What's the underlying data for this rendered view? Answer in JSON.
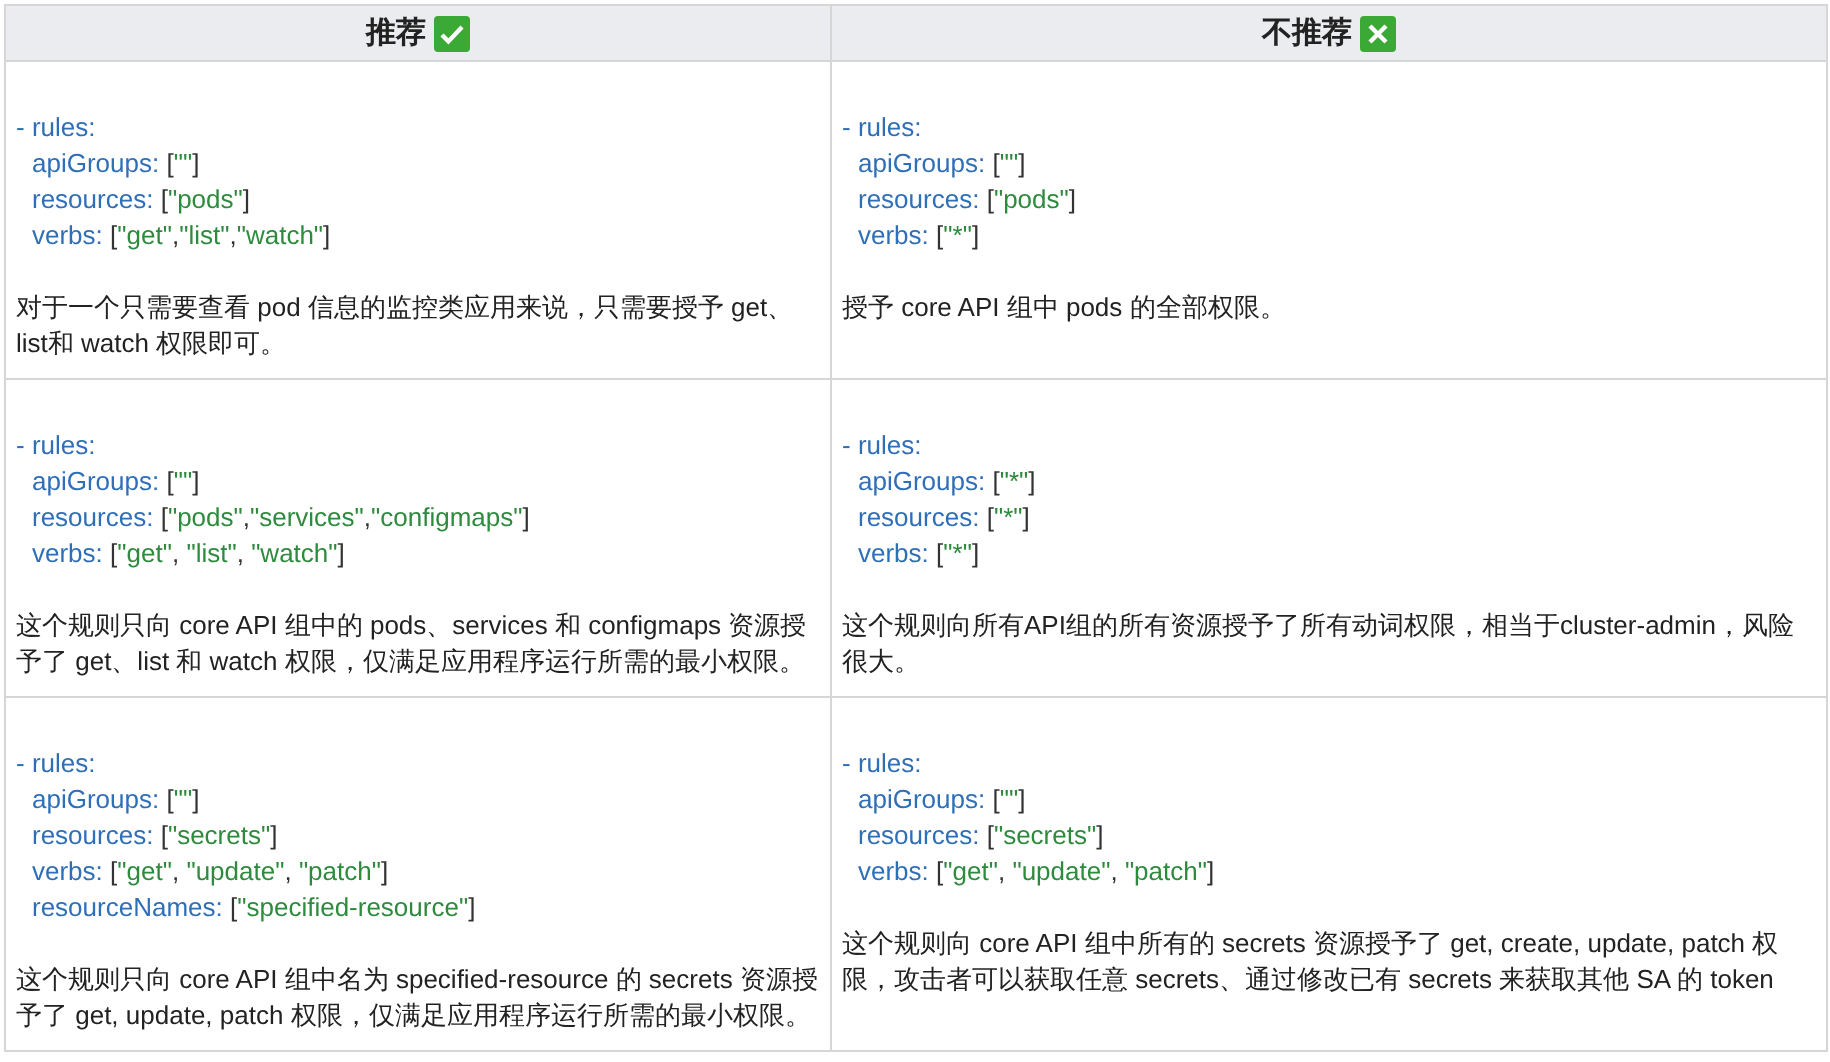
{
  "table": {
    "columns": [
      {
        "label": "推荐",
        "kind": "check"
      },
      {
        "label": "不推荐",
        "kind": "cross"
      }
    ],
    "rows": [
      {
        "cells": [
          {
            "code": [
              {
                "key": "- rules:",
                "children": [
                  {
                    "key": "apiGroups:",
                    "value": "[\"\"]"
                  },
                  {
                    "key": "resources:",
                    "value": "[\"pods\"]"
                  },
                  {
                    "key": "verbs:",
                    "value": "[\"get\",\"list\",\"watch\"]"
                  }
                ]
              }
            ],
            "description": "对于一个只需要查看 pod 信息的监控类应用来说，只需要授予 get、list和 watch 权限即可。"
          },
          {
            "code": [
              {
                "key": "- rules:",
                "children": [
                  {
                    "key": "apiGroups:",
                    "value": "[\"\"]"
                  },
                  {
                    "key": "resources:",
                    "value": "[\"pods\"]"
                  },
                  {
                    "key": "verbs:",
                    "value": "[\"*\"]"
                  }
                ]
              }
            ],
            "description": "授予 core API  组中 pods 的全部权限。"
          }
        ]
      },
      {
        "cells": [
          {
            "code": [
              {
                "key": "- rules:",
                "children": [
                  {
                    "key": "apiGroups:",
                    "value": "[\"\"]"
                  },
                  {
                    "key": "resources:",
                    "value": "[\"pods\",\"services\",\"configmaps\"]"
                  },
                  {
                    "key": "verbs:",
                    "value": "[\"get\", \"list\", \"watch\"]"
                  }
                ]
              }
            ],
            "description": "这个规则只向 core API 组中的 pods、services 和 configmaps 资源授予了 get、list 和 watch 权限，仅满足应用程序运行所需的最小权限。"
          },
          {
            "code": [
              {
                "key": "- rules:",
                "children": [
                  {
                    "key": "apiGroups:",
                    "value": "[\"*\"]"
                  },
                  {
                    "key": "resources:",
                    "value": "[\"*\"]"
                  },
                  {
                    "key": "verbs:",
                    "value": "[\"*\"]"
                  }
                ]
              }
            ],
            "description": "这个规则向所有API组的所有资源授予了所有动词权限，相当于cluster-admin，风险很大。"
          }
        ]
      },
      {
        "cells": [
          {
            "code": [
              {
                "key": "- rules:",
                "children": [
                  {
                    "key": "apiGroups:",
                    "value": "[\"\"]"
                  },
                  {
                    "key": "resources:",
                    "value": "[\"secrets\"]"
                  },
                  {
                    "key": "verbs:",
                    "value": "[\"get\", \"update\", \"patch\"]"
                  },
                  {
                    "key": "resourceNames:",
                    "value": "[\"specified-resource\"]"
                  }
                ]
              }
            ],
            "description": "这个规则只向 core API 组中名为 specified-resource 的 secrets 资源授予了 get, update, patch 权限，仅满足应用程序运行所需的最小权限。"
          },
          {
            "code": [
              {
                "key": "- rules:",
                "children": [
                  {
                    "key": "apiGroups:",
                    "value": "[\"\"]"
                  },
                  {
                    "key": "resources:",
                    "value": "[\"secrets\"]"
                  },
                  {
                    "key": "verbs:",
                    "value": "[\"get\", \"update\", \"patch\"]"
                  }
                ]
              }
            ],
            "description": "这个规则向 core API 组中所有的 secrets 资源授予了 get, create, update, patch 权限，攻击者可以获取任意 secrets、通过修改已有 secrets 来获取其他 SA 的 token"
          }
        ]
      }
    ]
  }
}
